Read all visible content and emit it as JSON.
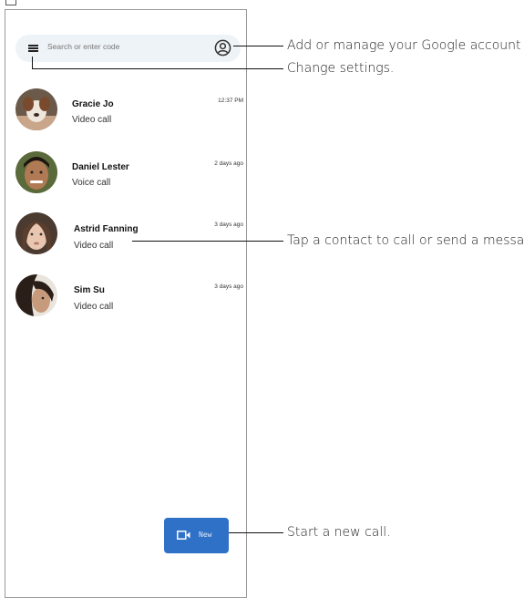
{
  "search": {
    "placeholder": "Search or enter code"
  },
  "contacts": [
    {
      "name": "Gracie Jo",
      "type": "Video call",
      "time": "12:37 PM"
    },
    {
      "name": "Daniel Lester",
      "type": "Voice call",
      "time": "2 days ago"
    },
    {
      "name": "Astrid Fanning",
      "type": "Video call",
      "time": "3 days ago"
    },
    {
      "name": "Sim Su",
      "type": "Video call",
      "time": "3 days ago"
    }
  ],
  "fab": {
    "label": "New",
    "icon": "video-camera-icon"
  },
  "callouts": {
    "account": "Add or manage your Google account",
    "settings": "Change settings.",
    "contact": "Tap a contact to call or send a message",
    "new_call": "Start a new call."
  },
  "colors": {
    "fab": "#2f71c7",
    "search_bg": "#eef3f7"
  }
}
